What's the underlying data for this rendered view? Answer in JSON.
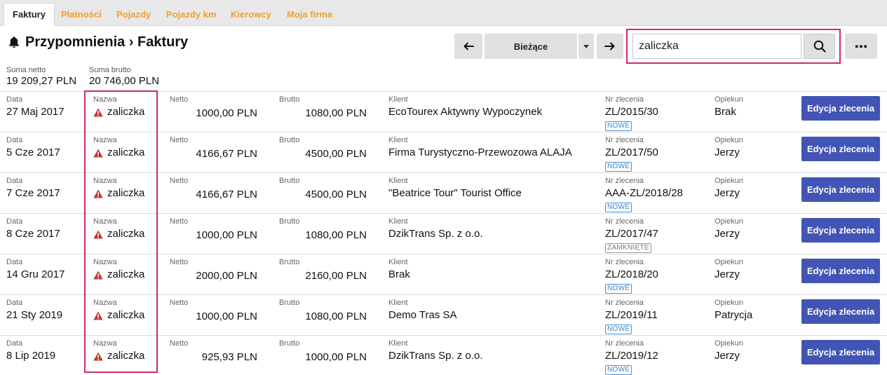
{
  "tabs": [
    "Faktury",
    "Płatności",
    "Pojazdy",
    "Pojazdy km",
    "Kierowcy",
    "Moja firma"
  ],
  "header": {
    "title": "Przypomnienia › Faktury"
  },
  "toolbar": {
    "period_label": "Bieżące"
  },
  "search": {
    "value": "zaliczka"
  },
  "totals": {
    "net_label": "Suma netto",
    "net_value": "19 209,27 PLN",
    "gross_label": "Suma brutto",
    "gross_value": "20 746,00 PLN"
  },
  "columns": {
    "date": "Data",
    "name": "Nazwa",
    "net": "Netto",
    "gross": "Brutto",
    "client": "Klient",
    "order": "Nr zlecenia",
    "guardian": "Opiekun"
  },
  "edit_label": "Edycja zlecenia",
  "rows": [
    {
      "date": "27 Maj 2017",
      "name": "zaliczka",
      "net": "1000,00 PLN",
      "gross": "1080,00 PLN",
      "client": "EcoTourex Aktywny Wypoczynek",
      "order": "ZL/2015/30",
      "status": "NOWE",
      "guardian": "Brak"
    },
    {
      "date": "5 Cze 2017",
      "name": "zaliczka",
      "net": "4166,67 PLN",
      "gross": "4500,00 PLN",
      "client": "Firma Turystyczno-Przewozowa ALAJA",
      "order": "ZL/2017/50",
      "status": "NOWE",
      "guardian": "Jerzy"
    },
    {
      "date": "7 Cze 2017",
      "name": "zaliczka",
      "net": "4166,67 PLN",
      "gross": "4500,00 PLN",
      "client": "\"Beatrice Tour\" Tourist Office",
      "order": "AAA-ZL/2018/28",
      "status": "NOWE",
      "guardian": "Jerzy"
    },
    {
      "date": "8 Cze 2017",
      "name": "zaliczka",
      "net": "1000,00 PLN",
      "gross": "1080,00 PLN",
      "client": "DzikTrans Sp. z o.o.",
      "order": "ZL/2017/47",
      "status": "ZAMKNIĘTE",
      "guardian": "Jerzy"
    },
    {
      "date": "14 Gru 2017",
      "name": "zaliczka",
      "net": "2000,00 PLN",
      "gross": "2160,00 PLN",
      "client": "Brak",
      "order": "ZL/2018/20",
      "status": "NOWE",
      "guardian": "Jerzy"
    },
    {
      "date": "21 Sty 2019",
      "name": "zaliczka",
      "net": "1000,00 PLN",
      "gross": "1080,00 PLN",
      "client": "Demo Tras SA",
      "order": "ZL/2019/11",
      "status": "NOWE",
      "guardian": "Patrycja"
    },
    {
      "date": "8 Lip 2019",
      "name": "zaliczka",
      "net": "925,93 PLN",
      "gross": "1000,00 PLN",
      "client": "DzikTrans Sp. z o.o.",
      "order": "ZL/2019/12",
      "status": "NOWE",
      "guardian": "Jerzy"
    }
  ],
  "colors": {
    "accent": "#f0a030",
    "primary": "#4254b5",
    "highlight": "#cc2a72",
    "warning": "#c0392b"
  }
}
